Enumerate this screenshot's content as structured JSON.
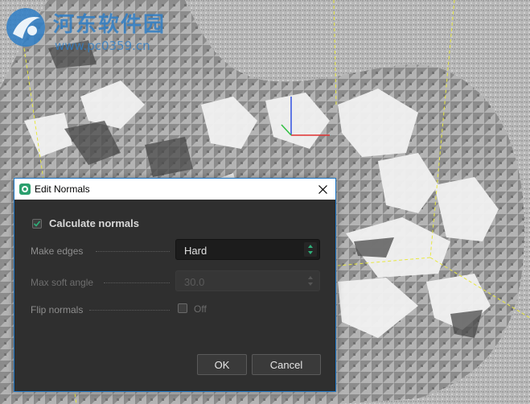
{
  "watermark": {
    "title": "河东软件园",
    "url": "www.pc0359.cn"
  },
  "dialog": {
    "title": "Edit Normals",
    "calculate_normals": {
      "label": "Calculate normals",
      "checked": true
    },
    "make_edges": {
      "label": "Make edges",
      "value": "Hard"
    },
    "max_soft_angle": {
      "label": "Max soft angle",
      "value": "30.0",
      "disabled": true
    },
    "flip_normals": {
      "label": "Flip normals",
      "state_label": "Off",
      "checked": false
    },
    "buttons": {
      "ok": "OK",
      "cancel": "Cancel"
    }
  },
  "colors": {
    "accent_border": "#1e78c8",
    "dialog_bg": "#2f2f2f",
    "app_icon": "#2b9f6e",
    "axis_x": "#e03030",
    "axis_y": "#30c040",
    "axis_z": "#3050e0",
    "bounding_box": "#e8e840"
  },
  "icons": {
    "app": "app-logo-icon",
    "close": "close-icon",
    "check": "checkmark-icon",
    "spinner": "spinner-arrows-icon"
  }
}
